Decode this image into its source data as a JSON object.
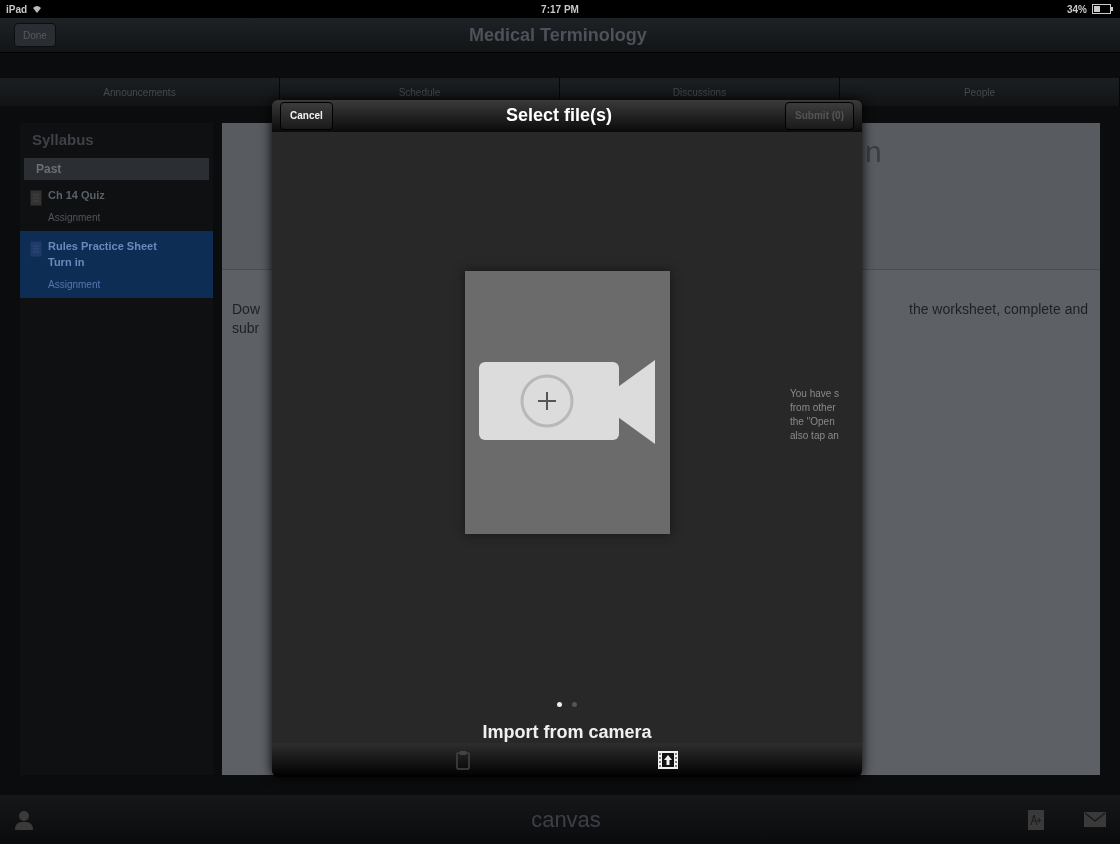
{
  "status_bar": {
    "carrier": "iPad",
    "time": "7:17 PM",
    "battery": "34%"
  },
  "nav_bar": {
    "back_button": "Done",
    "title": "Medical Terminology"
  },
  "tabs": [
    {
      "label": "Announcements",
      "selected": false
    },
    {
      "label": "Schedule",
      "selected": false
    },
    {
      "label": "Discussions",
      "selected": false
    },
    {
      "label": "People",
      "selected": false
    }
  ],
  "sidebar": {
    "title": "Syllabus",
    "section": "Past",
    "items": [
      {
        "title": "Ch 14 Quiz",
        "subtitle": "Assignment",
        "selected": false
      },
      {
        "title": "Rules Practice Sheet",
        "status": "Turn in",
        "subtitle": "Assignment",
        "selected": true
      }
    ]
  },
  "content": {
    "heading_fragment": "n",
    "text_left": [
      "Dow",
      "subr"
    ],
    "text_right": "the worksheet, complete and"
  },
  "modal": {
    "title": "Select file(s)",
    "cancel_button": "Cancel",
    "submit_button": {
      "label": "Submit (0)",
      "disabled": true
    },
    "next_page_text": [
      "You have s",
      "from other",
      "the \"Open",
      "also tap an"
    ],
    "pages": [
      {
        "selected": true
      },
      {
        "selected": false
      }
    ],
    "option_label": "Import from camera",
    "toolbar": [
      {
        "kind": "clipboard",
        "selected": false
      },
      {
        "kind": "media",
        "selected": true
      }
    ]
  },
  "bottom_bar": {
    "logo": "canvas"
  }
}
